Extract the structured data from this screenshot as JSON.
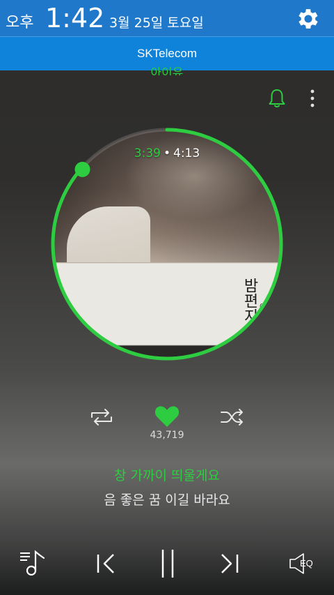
{
  "status_bar": {
    "ampm": "오후",
    "time": "1:42",
    "date": "3월 25일 토요일",
    "carrier": "SKTelecom"
  },
  "player": {
    "artist_peek": "아이유",
    "elapsed": "3:39",
    "separator": "•",
    "duration": "4:13",
    "progress": 0.865,
    "album_cover": {
      "title": "밤편지",
      "artist": "아이유"
    },
    "likes": "43,719",
    "liked": true,
    "lyrics": {
      "current": "창 가까이 띄울게요",
      "next": "음 좋은 꿈 이길 바라요"
    },
    "eq_label": "EQ"
  },
  "colors": {
    "accent": "#2ecc40",
    "header_blue": "#1f78c9",
    "carrier_blue": "#0f82d9"
  },
  "icons": {
    "settings": "gear-icon",
    "notify": "bell-icon",
    "more": "more-vert-icon",
    "repeat": "repeat-icon",
    "like": "heart-icon",
    "shuffle": "shuffle-icon",
    "playlist": "playlist-icon",
    "prev": "skip-previous-icon",
    "pause": "pause-icon",
    "next": "skip-next-icon",
    "eq": "equalizer-speaker-icon"
  }
}
